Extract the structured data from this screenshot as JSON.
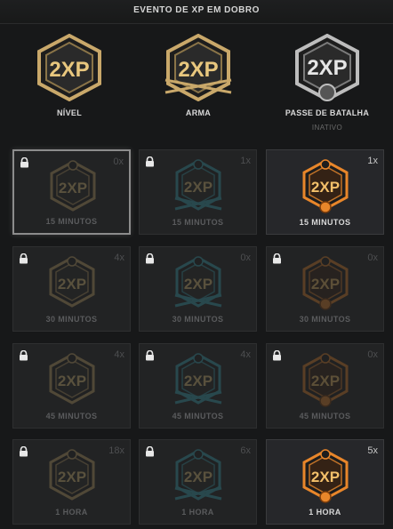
{
  "header": {
    "title": "EVENTO DE XP EM DOBRO"
  },
  "tokens": [
    {
      "label": "NÍVEL",
      "sub": "",
      "color": "#c9a86a"
    },
    {
      "label": "ARMA",
      "sub": "",
      "color": "#c9a86a"
    },
    {
      "label": "PASSE DE BATALHA",
      "sub": "INATIVO",
      "color": "#c8c8c8"
    }
  ],
  "badge_text": "2XP",
  "cards": [
    [
      {
        "duration": "15 MINUTOS",
        "count": "0x",
        "type": "level",
        "state": "selected",
        "locked": true
      },
      {
        "duration": "15 MINUTOS",
        "count": "1x",
        "type": "weapon",
        "state": "inactive",
        "locked": true
      },
      {
        "duration": "15 MINUTOS",
        "count": "1x",
        "type": "battlepass",
        "state": "active",
        "locked": false
      }
    ],
    [
      {
        "duration": "30 MINUTOS",
        "count": "4x",
        "type": "level",
        "state": "inactive",
        "locked": true
      },
      {
        "duration": "30 MINUTOS",
        "count": "0x",
        "type": "weapon",
        "state": "inactive",
        "locked": true
      },
      {
        "duration": "30 MINUTOS",
        "count": "0x",
        "type": "battlepass",
        "state": "inactive",
        "locked": true
      }
    ],
    [
      {
        "duration": "45 MINUTOS",
        "count": "4x",
        "type": "level",
        "state": "inactive",
        "locked": true
      },
      {
        "duration": "45 MINUTOS",
        "count": "4x",
        "type": "weapon",
        "state": "inactive",
        "locked": true
      },
      {
        "duration": "45 MINUTOS",
        "count": "0x",
        "type": "battlepass",
        "state": "inactive",
        "locked": true
      }
    ],
    [
      {
        "duration": "1 HORA",
        "count": "18x",
        "type": "level",
        "state": "inactive",
        "locked": true
      },
      {
        "duration": "1 HORA",
        "count": "6x",
        "type": "weapon",
        "state": "inactive",
        "locked": true
      },
      {
        "duration": "1 HORA",
        "count": "5x",
        "type": "battlepass",
        "state": "active",
        "locked": false
      }
    ]
  ],
  "colors": {
    "level_accent": "#c9a86a",
    "weapon_accent": "#3aa7b8",
    "battlepass_accent": "#e8862a",
    "background": "#171819"
  }
}
